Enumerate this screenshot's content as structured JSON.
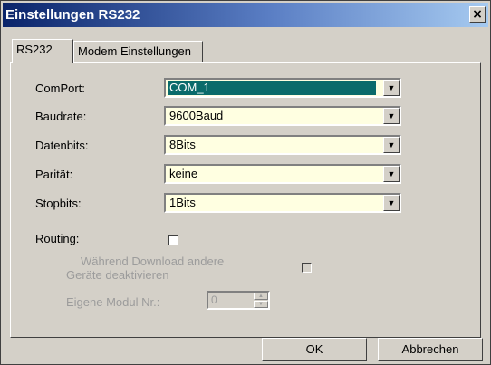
{
  "window": {
    "title": "Einstellungen RS232",
    "close_label": "×"
  },
  "tabs": [
    {
      "label": "RS232",
      "active": true
    },
    {
      "label": "Modem Einstellungen",
      "active": false
    }
  ],
  "fields": {
    "comport": {
      "label": "ComPort:",
      "value": "COM_1"
    },
    "baudrate": {
      "label": "Baudrate:",
      "value": "9600Baud"
    },
    "datenbits": {
      "label": "Datenbits:",
      "value": "8Bits"
    },
    "paritaet": {
      "label": "Parität:",
      "value": "keine"
    },
    "stopbits": {
      "label": "Stopbits:",
      "value": "1Bits"
    }
  },
  "routing": {
    "label": "Routing:",
    "checked": false
  },
  "deactivate": {
    "line1": "Während Download andere",
    "line2": "Geräte deaktivieren",
    "checked": false
  },
  "module": {
    "label": "Eigene Modul Nr.:",
    "value": "0"
  },
  "buttons": {
    "ok": "OK",
    "cancel": "Abbrechen"
  }
}
